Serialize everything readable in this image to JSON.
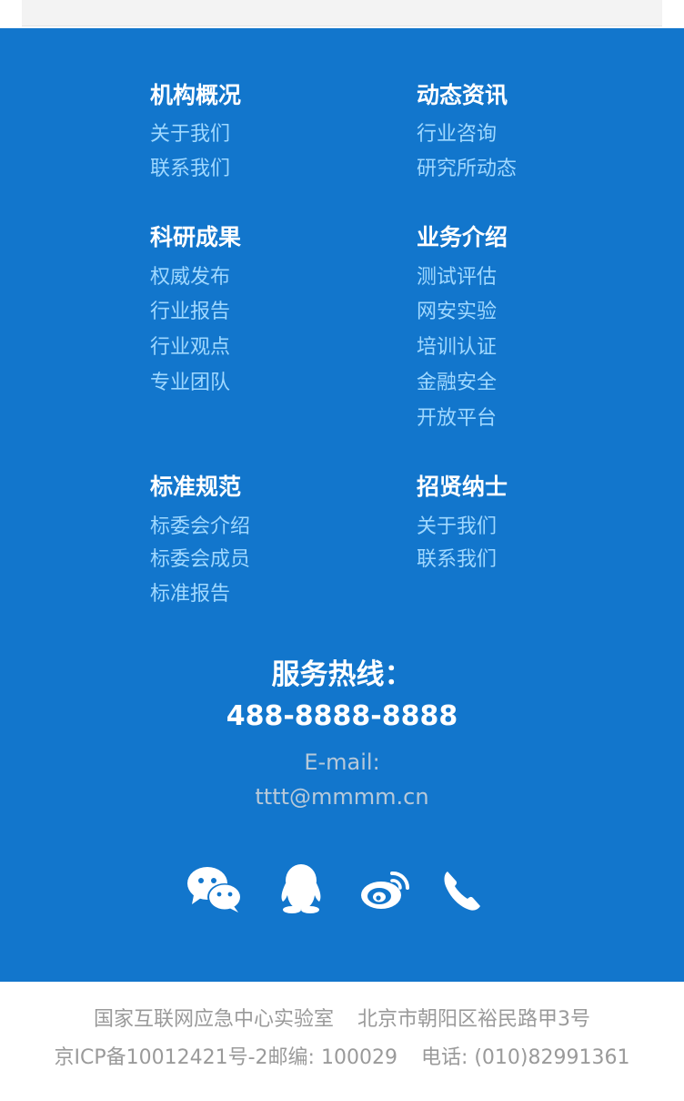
{
  "colors": {
    "background": "#1276cc",
    "heading": "#ffffff",
    "link": "#9fd8ff",
    "footer_text": "#9a9a9a"
  },
  "sections": [
    {
      "title": "机构概况",
      "links": [
        "关于我们",
        "联系我们"
      ]
    },
    {
      "title": "动态资讯",
      "links": [
        "行业咨询",
        "研究所动态"
      ]
    },
    {
      "title": "科研成果",
      "links": [
        "权威发布",
        "行业报告",
        "行业观点",
        "专业团队"
      ]
    },
    {
      "title": "业务介绍",
      "links": [
        "测试评估",
        "网安实验",
        "培训认证",
        "金融安全",
        "开放平台"
      ]
    },
    {
      "title": "标准规范",
      "links": [
        "标委会介绍",
        "标委会成员",
        "标准报告"
      ]
    },
    {
      "title": "招贤纳士",
      "links": [
        "关于我们",
        "联系我们"
      ]
    }
  ],
  "contact": {
    "hotline_label": "服务热线：",
    "hotline_number": "488-8888-8888",
    "email_label": "E-mail:",
    "email": "tttt@mmmm.cn"
  },
  "social_icons": [
    "wechat-icon",
    "qq-icon",
    "weibo-icon",
    "phone-icon"
  ],
  "footer": {
    "org": "国家互联网应急中心实验室",
    "address": "北京市朝阳区裕民路甲3号",
    "icp": "京ICP备10012421号-2",
    "postcode": "邮编: 100029",
    "phone": "电话: (010)82991361"
  }
}
